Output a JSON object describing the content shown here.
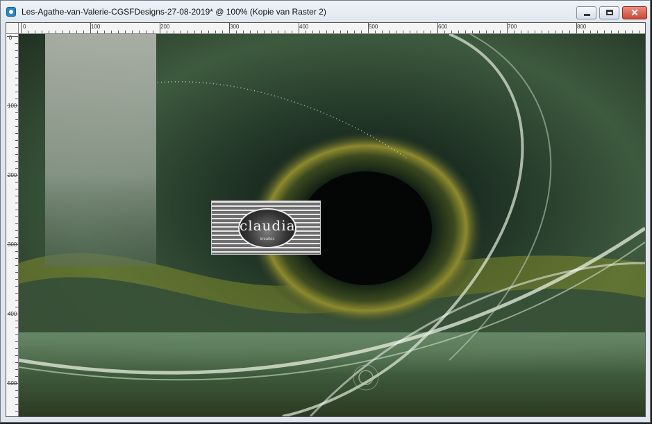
{
  "window": {
    "title": "Les-Agathe-van-Valerie-CGSFDesigns-27-08-2019* @ 100% (Kopie van Raster 2)",
    "close_glyph": "✕",
    "icons": {
      "app": "psp-app-icon",
      "minimize": "minimize-icon",
      "maximize": "maximize-icon",
      "close": "close-icon"
    }
  },
  "ruler": {
    "horizontal_labels": [
      "0",
      "100",
      "200",
      "300",
      "400",
      "500",
      "600",
      "700",
      "800"
    ],
    "vertical_labels": [
      "0",
      "100",
      "200",
      "300",
      "400",
      "500"
    ]
  },
  "artwork": {
    "logo_text": "claudia",
    "logo_subtext": "kreaties"
  },
  "colors": {
    "accent_green": "#2f4a34",
    "swirl_yellow": "#c9c34a",
    "close_red": "#c94736"
  }
}
